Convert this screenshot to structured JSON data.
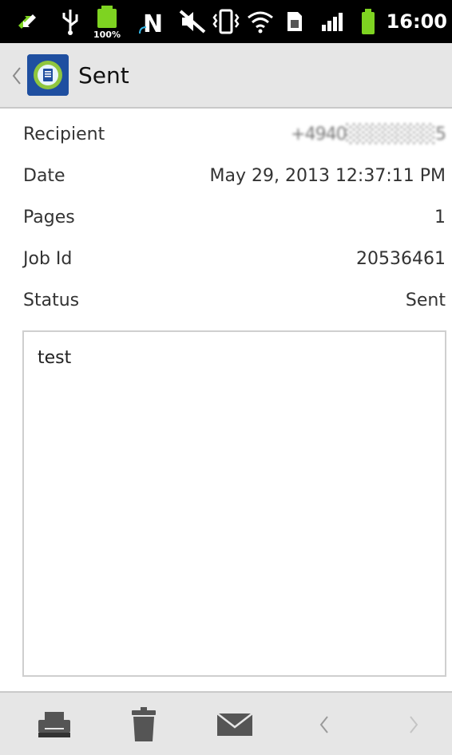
{
  "status_bar": {
    "time": "16:00",
    "battery_small_label": "100%",
    "icons": [
      "sync-icon",
      "usb-icon",
      "battery-full-icon",
      "nfc-icon",
      "mute-icon",
      "vibrate-icon",
      "wifi-icon",
      "sim-icon",
      "signal-icon",
      "battery-icon"
    ]
  },
  "action_bar": {
    "title": "Sent",
    "icon": "fax-app-icon"
  },
  "details": [
    {
      "label": "Recipient",
      "value": "+4940░░░░░░░5"
    },
    {
      "label": "Date",
      "value": "May 29, 2013 12:37:11 PM"
    },
    {
      "label": "Pages",
      "value": "1"
    },
    {
      "label": "Job Id",
      "value": "20536461"
    },
    {
      "label": "Status",
      "value": "Sent"
    }
  ],
  "message": {
    "text": "test"
  },
  "bottom_bar": {
    "buttons": [
      "print-icon",
      "delete-icon",
      "email-icon",
      "previous-icon",
      "next-icon"
    ]
  },
  "colors": {
    "accent": "#33b5e5",
    "status_bar": "#000000",
    "action_bar": "#e6e6e6",
    "battery_green": "#7ed321"
  }
}
